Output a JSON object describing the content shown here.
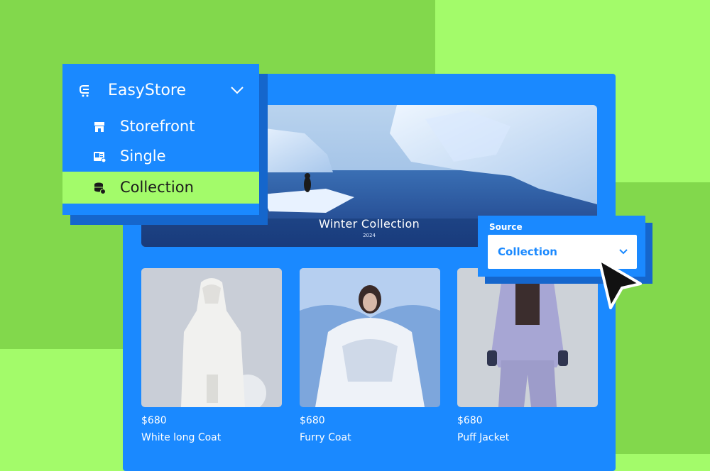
{
  "colors": {
    "accent_green": "#a3fb6a",
    "dark_green": "#82d84c",
    "brand_blue": "#1a89ff",
    "shadow_blue": "#1566cc"
  },
  "menu": {
    "brand_name": "EasyStore",
    "brand_icon": "cart-icon",
    "toggle_icon": "chevron-down-icon",
    "items": [
      {
        "label": "Storefront",
        "icon": "storefront-icon",
        "active": false
      },
      {
        "label": "Single",
        "icon": "single-product-icon",
        "active": false
      },
      {
        "label": "Collection",
        "icon": "collection-icon",
        "active": true
      }
    ]
  },
  "hero": {
    "title": "Winter Collection",
    "year": "2024"
  },
  "products": [
    {
      "price": "$680",
      "name": "White long Coat"
    },
    {
      "price": "$680",
      "name": "Furry Coat"
    },
    {
      "price": "$680",
      "name": "Puff Jacket"
    }
  ],
  "source": {
    "label": "Source",
    "value": "Collection"
  }
}
